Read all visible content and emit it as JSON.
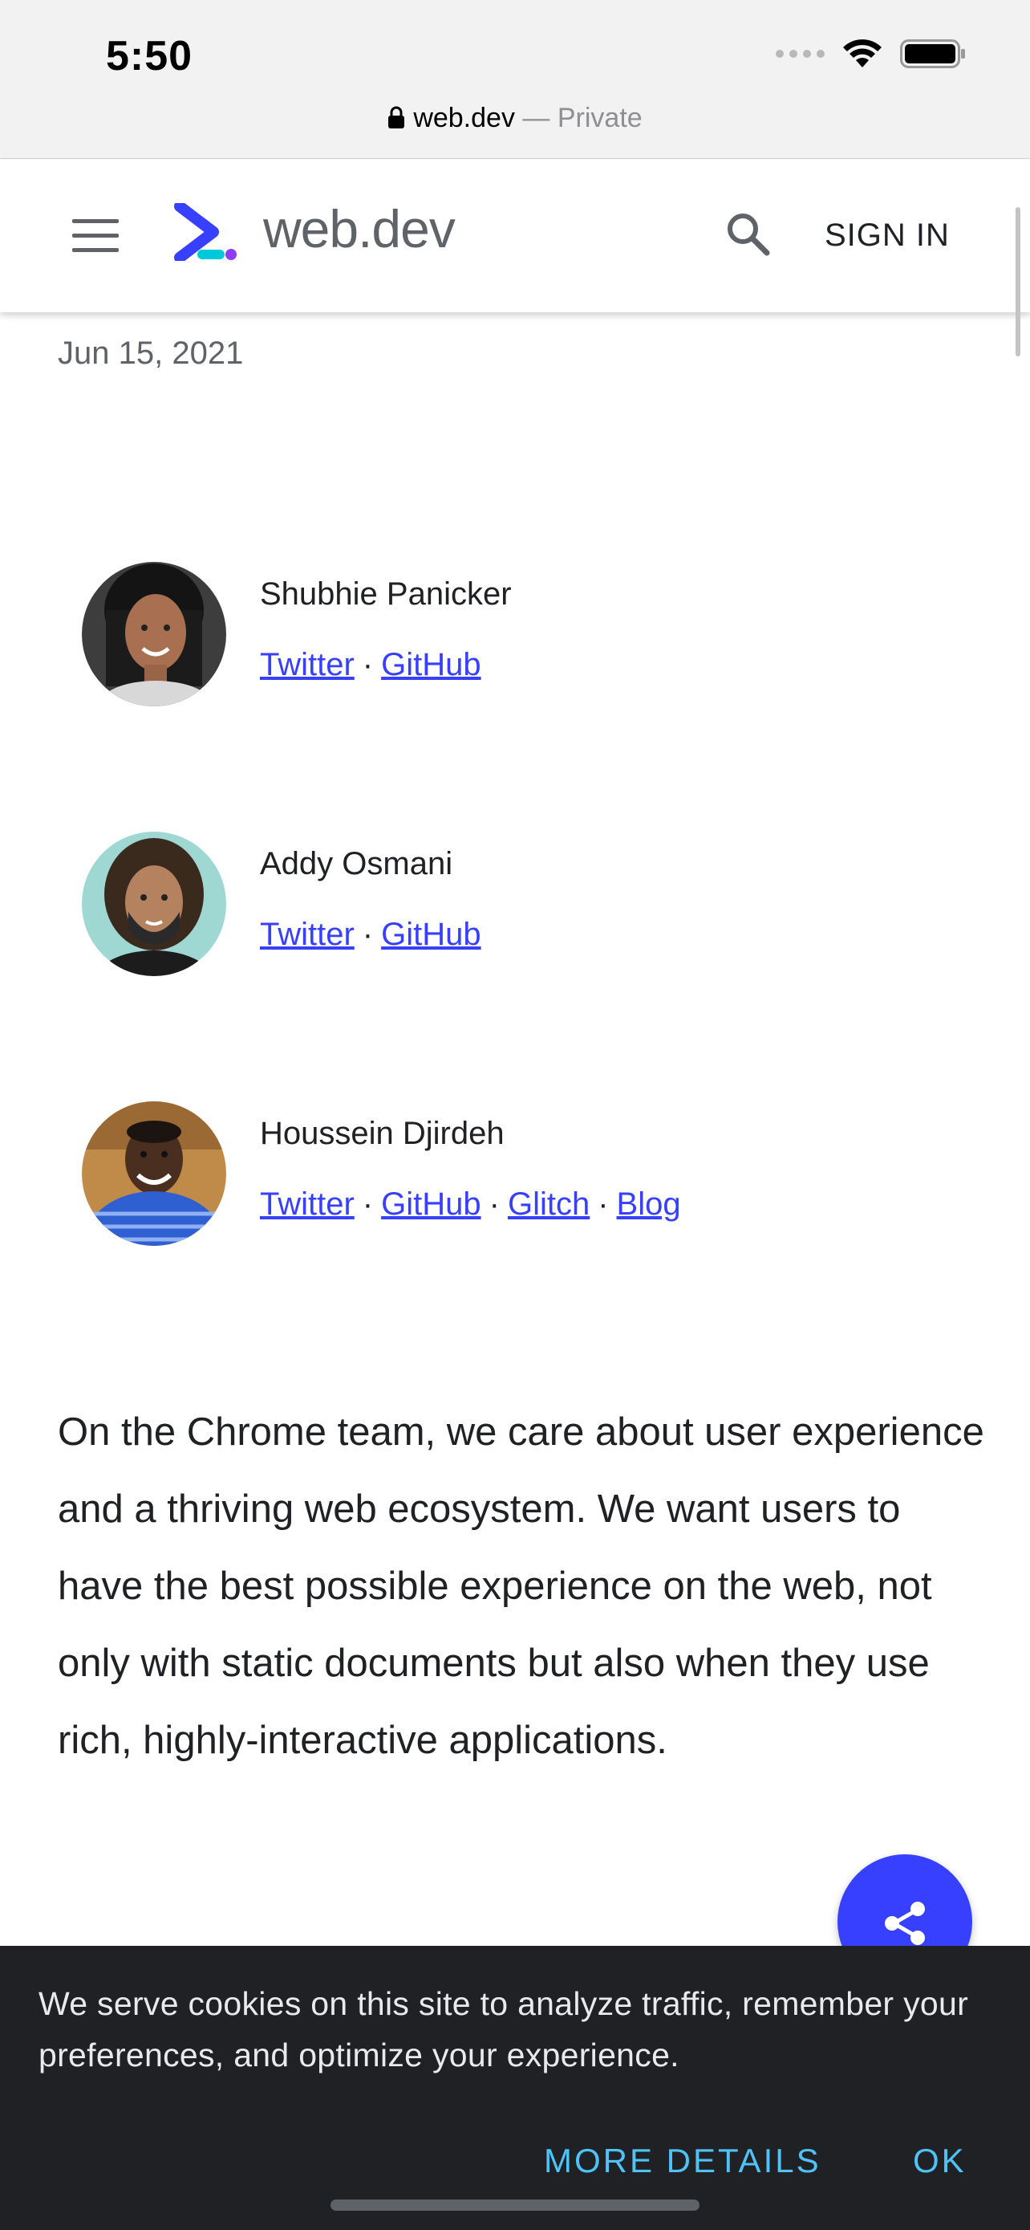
{
  "status_bar": {
    "time": "5:50"
  },
  "url_bar": {
    "domain": "web.dev",
    "separator": " — ",
    "mode": "Private"
  },
  "header": {
    "logo_text": "web.dev",
    "signin_label": "SIGN IN"
  },
  "article": {
    "date": "Jun 15, 2021",
    "authors": [
      {
        "name": "Shubhie Panicker",
        "links": [
          "Twitter",
          "GitHub"
        ]
      },
      {
        "name": "Addy Osmani",
        "links": [
          "Twitter",
          "GitHub"
        ]
      },
      {
        "name": "Houssein Djirdeh",
        "links": [
          "Twitter",
          "GitHub",
          "Glitch",
          "Blog"
        ]
      }
    ],
    "link_separator": "·",
    "intro": "On the Chrome team, we care about user experience and a thriving web ecosystem. We want users to have the best possible experience on the web, not only with static documents but also when they use rich, highly-interactive applications."
  },
  "cookie_banner": {
    "text": "We serve cookies on this site to analyze traffic, remember your preferences, and optimize your experience.",
    "more_details_label": "MORE DETAILS",
    "ok_label": "OK"
  },
  "colors": {
    "link": "#3740ff",
    "fab": "#3740ff",
    "cookie_bg": "#202124",
    "cookie_action": "#4fc3f7"
  }
}
